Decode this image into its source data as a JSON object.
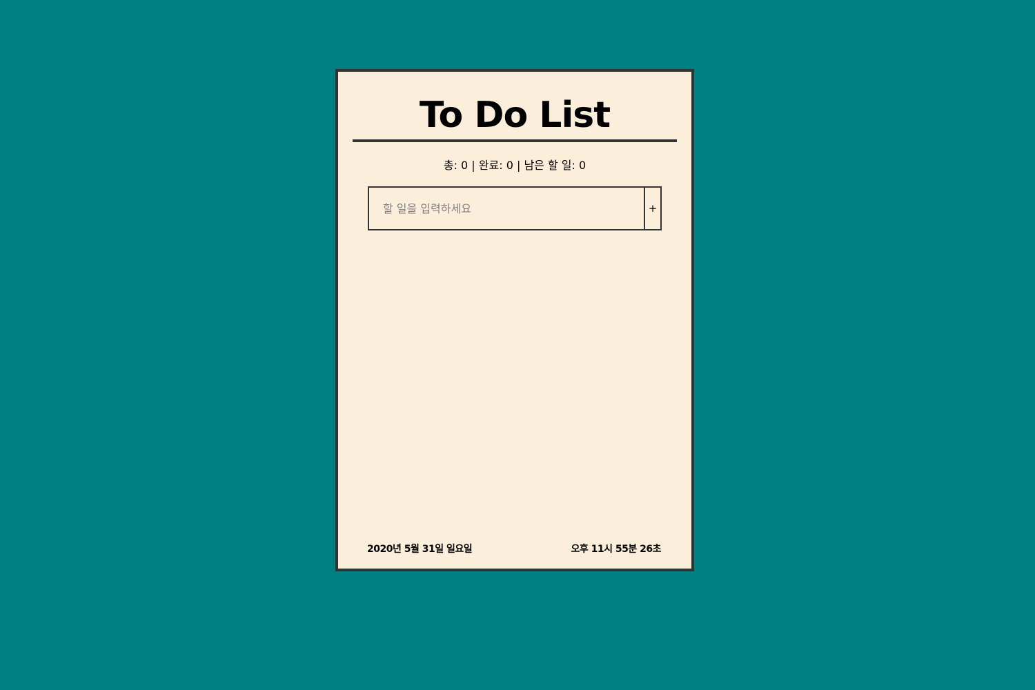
{
  "colors": {
    "background": "#008080",
    "card_background": "#fbeedb",
    "border": "#333333",
    "text": "#000000",
    "placeholder": "#808080"
  },
  "header": {
    "title": "To Do List"
  },
  "stats": {
    "text": "총: 0 | 완료: 0 | 남은 할 일: 0"
  },
  "form": {
    "placeholder": "할 일을 입력하세요",
    "value": "",
    "add_label": "+"
  },
  "todos": [],
  "footer": {
    "date": "2020년 5월 31일 일요일",
    "time": "오후 11시 55분 26초"
  }
}
